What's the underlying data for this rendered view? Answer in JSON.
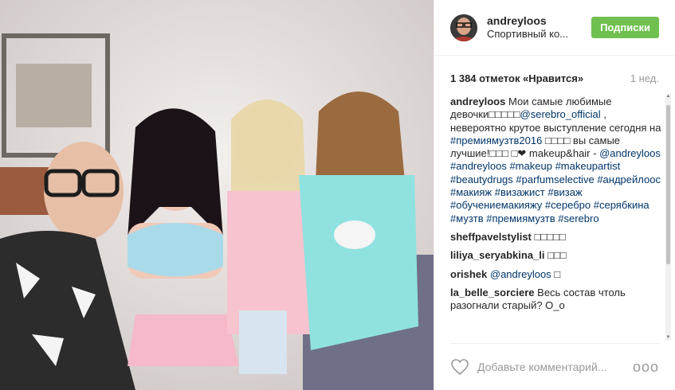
{
  "header": {
    "username": "andreyloos",
    "location": "Спортивный ко...",
    "follow_label": "Подписки"
  },
  "stats": {
    "likes": "1 384 отметок «Нравится»",
    "time_ago": "1 нед."
  },
  "caption": {
    "user": "andreyloos",
    "parts": [
      {
        "t": "Мои самые любимые девочки□□□□□",
        "tag": false
      },
      {
        "t": "@serebro_official",
        "tag": true
      },
      {
        "t": " , невероятно крутое выступление сегодня на ",
        "tag": false
      },
      {
        "t": "#премиямузтв2016",
        "tag": true
      },
      {
        "t": " □□□□ вы самые лучшие!□□□ □❤ makeup&hair - ",
        "tag": false
      },
      {
        "t": "@andreyloos",
        "tag": true
      },
      {
        "t": " ",
        "tag": false
      },
      {
        "t": "#andreyloos",
        "tag": true
      },
      {
        "t": " ",
        "tag": false
      },
      {
        "t": "#makeup",
        "tag": true
      },
      {
        "t": " ",
        "tag": false
      },
      {
        "t": "#makeupartist",
        "tag": true
      },
      {
        "t": " ",
        "tag": false
      },
      {
        "t": "#beautydrugs",
        "tag": true
      },
      {
        "t": " ",
        "tag": false
      },
      {
        "t": "#parfumselective",
        "tag": true
      },
      {
        "t": " ",
        "tag": false
      },
      {
        "t": "#андрейлоос",
        "tag": true
      },
      {
        "t": " ",
        "tag": false
      },
      {
        "t": "#макияж",
        "tag": true
      },
      {
        "t": " ",
        "tag": false
      },
      {
        "t": "#визажист",
        "tag": true
      },
      {
        "t": " ",
        "tag": false
      },
      {
        "t": "#визаж",
        "tag": true
      },
      {
        "t": " ",
        "tag": false
      },
      {
        "t": "#обучениемакияжу",
        "tag": true
      },
      {
        "t": " ",
        "tag": false
      },
      {
        "t": "#серебро",
        "tag": true
      },
      {
        "t": " ",
        "tag": false
      },
      {
        "t": "#серябкина",
        "tag": true
      },
      {
        "t": " ",
        "tag": false
      },
      {
        "t": "#музтв",
        "tag": true
      },
      {
        "t": " ",
        "tag": false
      },
      {
        "t": "#премиямузтв",
        "tag": true
      },
      {
        "t": " ",
        "tag": false
      },
      {
        "t": "#serebro",
        "tag": true
      }
    ]
  },
  "comments": [
    {
      "user": "sheffpavelstylist",
      "parts": [
        {
          "t": "□□□□□",
          "tag": false
        }
      ]
    },
    {
      "user": "liliya_seryabkina_li",
      "parts": [
        {
          "t": "□□□",
          "tag": false
        }
      ]
    },
    {
      "user": "orishek",
      "parts": [
        {
          "t": "@andreyloos",
          "tag": true
        },
        {
          "t": " □",
          "tag": false
        }
      ]
    },
    {
      "user": "la_belle_sorciere",
      "parts": [
        {
          "t": "Весь состав чтоль разогнали старый? О_о",
          "tag": false
        }
      ]
    }
  ],
  "footer": {
    "placeholder": "Добавьте комментарий...",
    "more": "ooo"
  },
  "colors": {
    "follow": "#70c050",
    "link": "#003569"
  }
}
